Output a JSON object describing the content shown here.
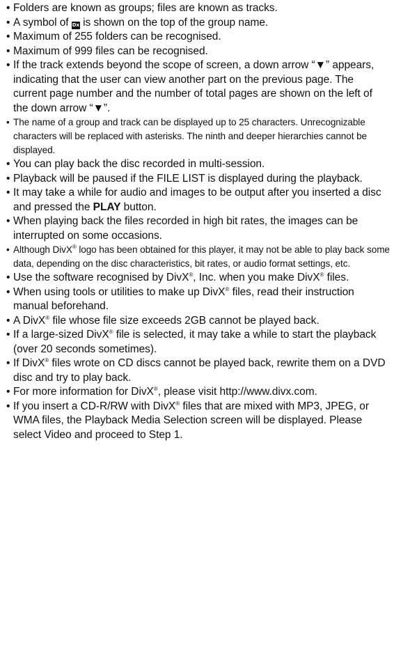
{
  "notes": [
    {
      "text": "Folders are known as groups; files are known as tracks."
    },
    {
      "pre": "A symbol of ",
      "icon": "group-folder-icon",
      "icon_glyph": "Dx",
      "post": " is shown on the top of the group name."
    },
    {
      "text": "Maximum of 255 folders can be recognised."
    },
    {
      "text": "Maximum of 999 files can be recognised."
    },
    {
      "text": "If the track extends beyond the scope of screen, a down arrow “▼” appears, indicating that the user can view another part on the previous page. The current page number and the number of total pages are shown on the left of the down arrow “▼”."
    },
    {
      "text": "The name of a group and track can be displayed up to 25 characters. Unrecognizable characters will be replaced with asterisks. The ninth and deeper hierarchies cannot be displayed."
    },
    {
      "text": "You can play back the disc recorded in multi-session."
    },
    {
      "text": "Playback will be paused if the FILE LIST is displayed during the playback."
    },
    {
      "pre": "It may take a while for audio and images to be output after you inserted a disc and pressed the ",
      "bold": "PLAY",
      "post": " button."
    },
    {
      "text": "When playing back the files recorded in high bit rates, the images can be interrupted on some occasions."
    },
    {
      "pre": "Although DivX",
      "reg": "®",
      "post": " logo has been obtained for this player, it may not be able to play back some data, depending on the disc characteristics, bit rates, or audio format settings, etc."
    },
    {
      "pre": "Use the software recognised by DivX",
      "reg": "®",
      "post": ", Inc. when you make DivX",
      "reg2": "®",
      "post2": " files."
    },
    {
      "pre": "When using tools or utilities to make up DivX",
      "reg": "®",
      "post": " files, read their instruction manual beforehand."
    },
    {
      "pre": "A DivX",
      "reg": "®",
      "post": " file whose file size exceeds 2GB cannot be played back."
    },
    {
      "pre": "If a large-sized DivX",
      "reg": "®",
      "post": " file is selected, it may take a while to start the playback (over 20 seconds sometimes)."
    },
    {
      "pre": "If DivX",
      "reg": "®",
      "post": " files wrote on CD discs cannot be played back, rewrite them on a DVD disc and try to play back."
    },
    {
      "pre": "For more information for DivX",
      "reg": "®",
      "post": ", please visit http://www.divx.com."
    },
    {
      "pre": "If you insert a CD-R/RW with DivX",
      "reg": "®",
      "post": " files that are mixed with MP3, JPEG, or WMA files, the Playback Media Selection screen will be displayed. Please select Video and proceed to Step 1."
    }
  ],
  "bullet": "•"
}
